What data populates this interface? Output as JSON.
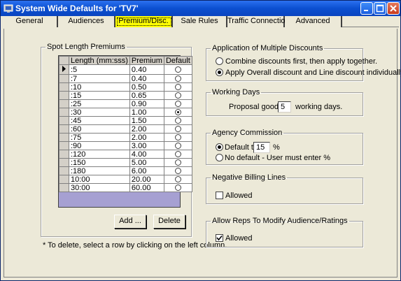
{
  "window": {
    "title": "System Wide Defaults for 'TV7'"
  },
  "tabs": [
    {
      "label": "General",
      "active": false
    },
    {
      "label": "Audiences",
      "active": false
    },
    {
      "label": "Premium/Disc.",
      "active": true
    },
    {
      "label": "Sale Rules",
      "active": false
    },
    {
      "label": "Traffic Connection",
      "active": false
    },
    {
      "label": "Advanced",
      "active": false
    }
  ],
  "spot_premiums": {
    "legend": "Spot Length Premiums",
    "columns": [
      "Length (mm:sss)",
      "Premium",
      "Default"
    ],
    "rows": [
      {
        "length": ":5",
        "premium": "0.40",
        "default": false,
        "current": true
      },
      {
        "length": ":7",
        "premium": "0.40",
        "default": false
      },
      {
        "length": ":10",
        "premium": "0.50",
        "default": false
      },
      {
        "length": ":15",
        "premium": "0.65",
        "default": false
      },
      {
        "length": ":25",
        "premium": "0.90",
        "default": false
      },
      {
        "length": ":30",
        "premium": "1.00",
        "default": true
      },
      {
        "length": ":45",
        "premium": "1.50",
        "default": false
      },
      {
        "length": ":60",
        "premium": "2.00",
        "default": false
      },
      {
        "length": ":75",
        "premium": "2.00",
        "default": false
      },
      {
        "length": ":90",
        "premium": "3.00",
        "default": false
      },
      {
        "length": ":120",
        "premium": "4.00",
        "default": false
      },
      {
        "length": ":150",
        "premium": "5.00",
        "default": false
      },
      {
        "length": ":180",
        "premium": "6.00",
        "default": false
      },
      {
        "length": "10:00",
        "premium": "20.00",
        "default": false
      },
      {
        "length": "30:00",
        "premium": "60.00",
        "default": false
      }
    ],
    "add_label": "Add ...",
    "delete_label": "Delete",
    "hint": "* To delete, select a row by clicking on the left column."
  },
  "multiple_discounts": {
    "legend": "Application of Multiple Discounts",
    "option_combine": "Combine discounts first, then apply together.",
    "option_apply": "Apply Overall discount and Line discount individually.",
    "selected": "apply"
  },
  "working_days": {
    "legend": "Working Days",
    "prefix": "Proposal good for",
    "value": "5",
    "suffix": "working days."
  },
  "agency_commission": {
    "legend": "Agency Commission",
    "default_label": "Default to",
    "default_value": "15",
    "percent": "%",
    "no_default_label": "No default - User must enter %",
    "selected": "default"
  },
  "negative_billing": {
    "legend": "Negative Billing Lines",
    "allowed_label": "Allowed",
    "checked": false
  },
  "reps_modify": {
    "legend": "Allow Reps To Modify Audience/Ratings",
    "allowed_label": "Allowed",
    "checked": true
  },
  "colors": {
    "titlebar": "#0b4fd0",
    "active_tab": "#ffff00",
    "grid_bg": "#a6a0d2",
    "window_bg": "#ece9d8"
  }
}
